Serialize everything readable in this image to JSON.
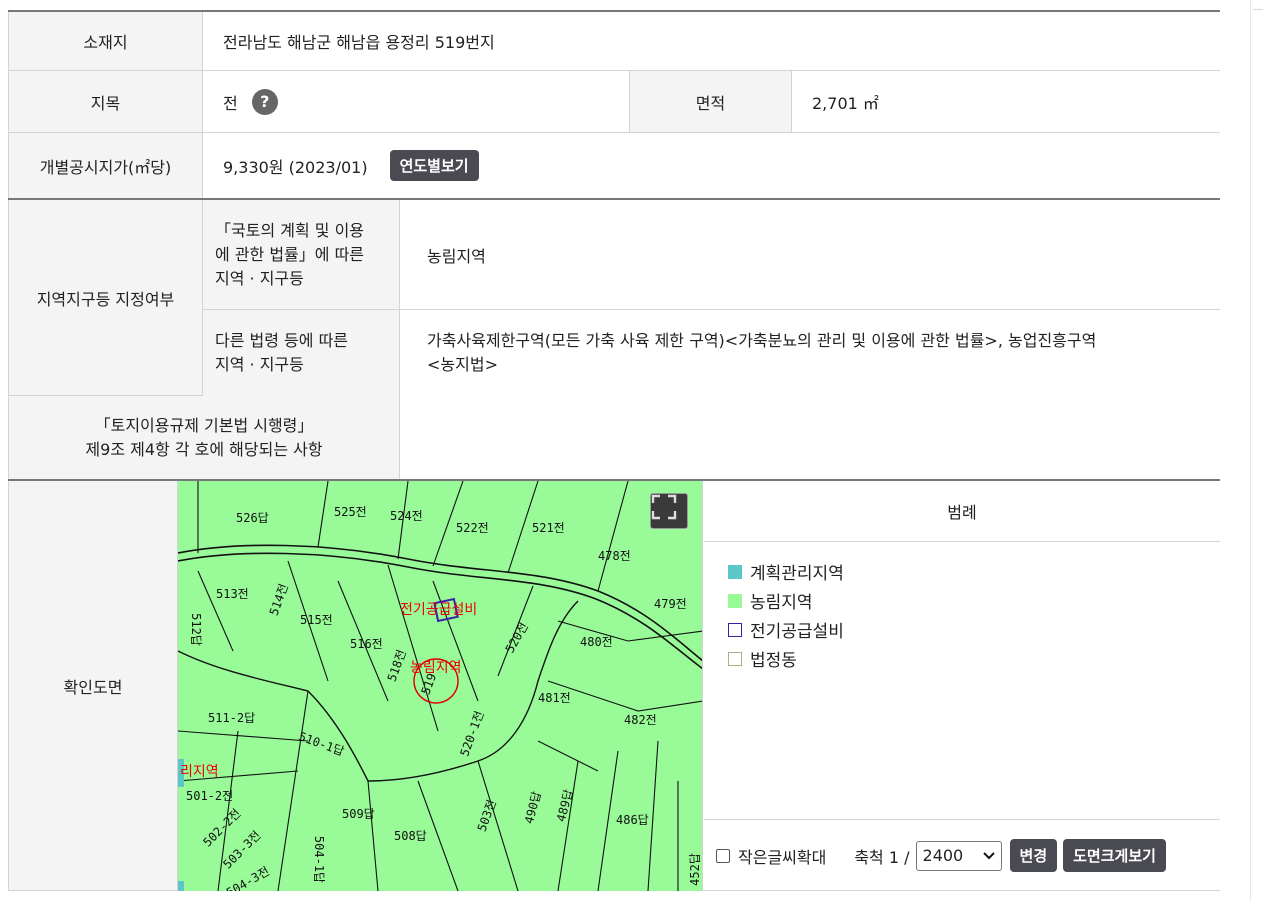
{
  "land": {
    "location_label": "소재지",
    "location_value": "전라남도 해남군 해남읍 용정리 519번지",
    "category_label": "지목",
    "category_value": "전",
    "help_glyph": "?",
    "area_label": "면적",
    "area_value": "2,701 ㎡",
    "price_label": "개별공시지가(㎡당)",
    "price_value": "9,330원 (2023/01)",
    "price_button": "연도별보기"
  },
  "zoning": {
    "label": "지역지구등 지정여부",
    "national_label_line1": "「국토의 계획 및 이용",
    "national_label_line2": "에 관한 법률」에 따른",
    "national_label_line3": "지역 · 지구등",
    "national_value": "농림지역",
    "other_label_line1": "다른 법령 등에 따른",
    "other_label_line2": "지역 · 지구등",
    "other_value_line1": "가축사육제한구역(모든 가축 사육 제한 구역)<가축분뇨의 관리 및 이용에 관한 법률>, 농업진흥구역",
    "other_value_line2": "<농지법>"
  },
  "regulation": {
    "label_line1": "「토지이용규제 기본법 시행령」",
    "label_line2": "제9조 제4항 각 호에 해당되는 사항",
    "value": ""
  },
  "map_section": {
    "label": "확인도면",
    "lots": [
      "526답",
      "525전",
      "524전",
      "522전",
      "521전",
      "478전",
      "513전",
      "514전",
      "515전",
      "516전",
      "479전",
      "480전",
      "512답",
      "518전",
      "519",
      "520전",
      "481전",
      "482전",
      "511-2답",
      "510-1답",
      "520-1전",
      "501-2전",
      "502-2전",
      "503-3전",
      "504-1답",
      "509답",
      "508답",
      "486답",
      "504-3전",
      "503전",
      "490답",
      "489답",
      "452답"
    ],
    "zone_labels": [
      "전기공급설비",
      "농림지역",
      "리지역"
    ],
    "colors": {
      "map_bg": "#98fb98",
      "planning": "#5bc7c7",
      "agri": "#98fb98",
      "power": "#3a1fa8",
      "legal_dong": "#b8a98a",
      "parcel_red": "#e00000"
    }
  },
  "legend": {
    "title": "범례",
    "items": [
      {
        "label": "계획관리지역",
        "type": "fill",
        "color": "#5bc7c7"
      },
      {
        "label": "농림지역",
        "type": "fill",
        "color": "#98fb98"
      },
      {
        "label": "전기공급설비",
        "type": "outline",
        "color": "#3a1fa8"
      },
      {
        "label": "법정동",
        "type": "outline",
        "color": "#b8a98a"
      }
    ],
    "enlarge_text_label": "작은글씨확대",
    "scale_label": "축척 1 /",
    "scale_value": "2400",
    "change_button": "변경",
    "big_map_button": "도면크게보기"
  }
}
